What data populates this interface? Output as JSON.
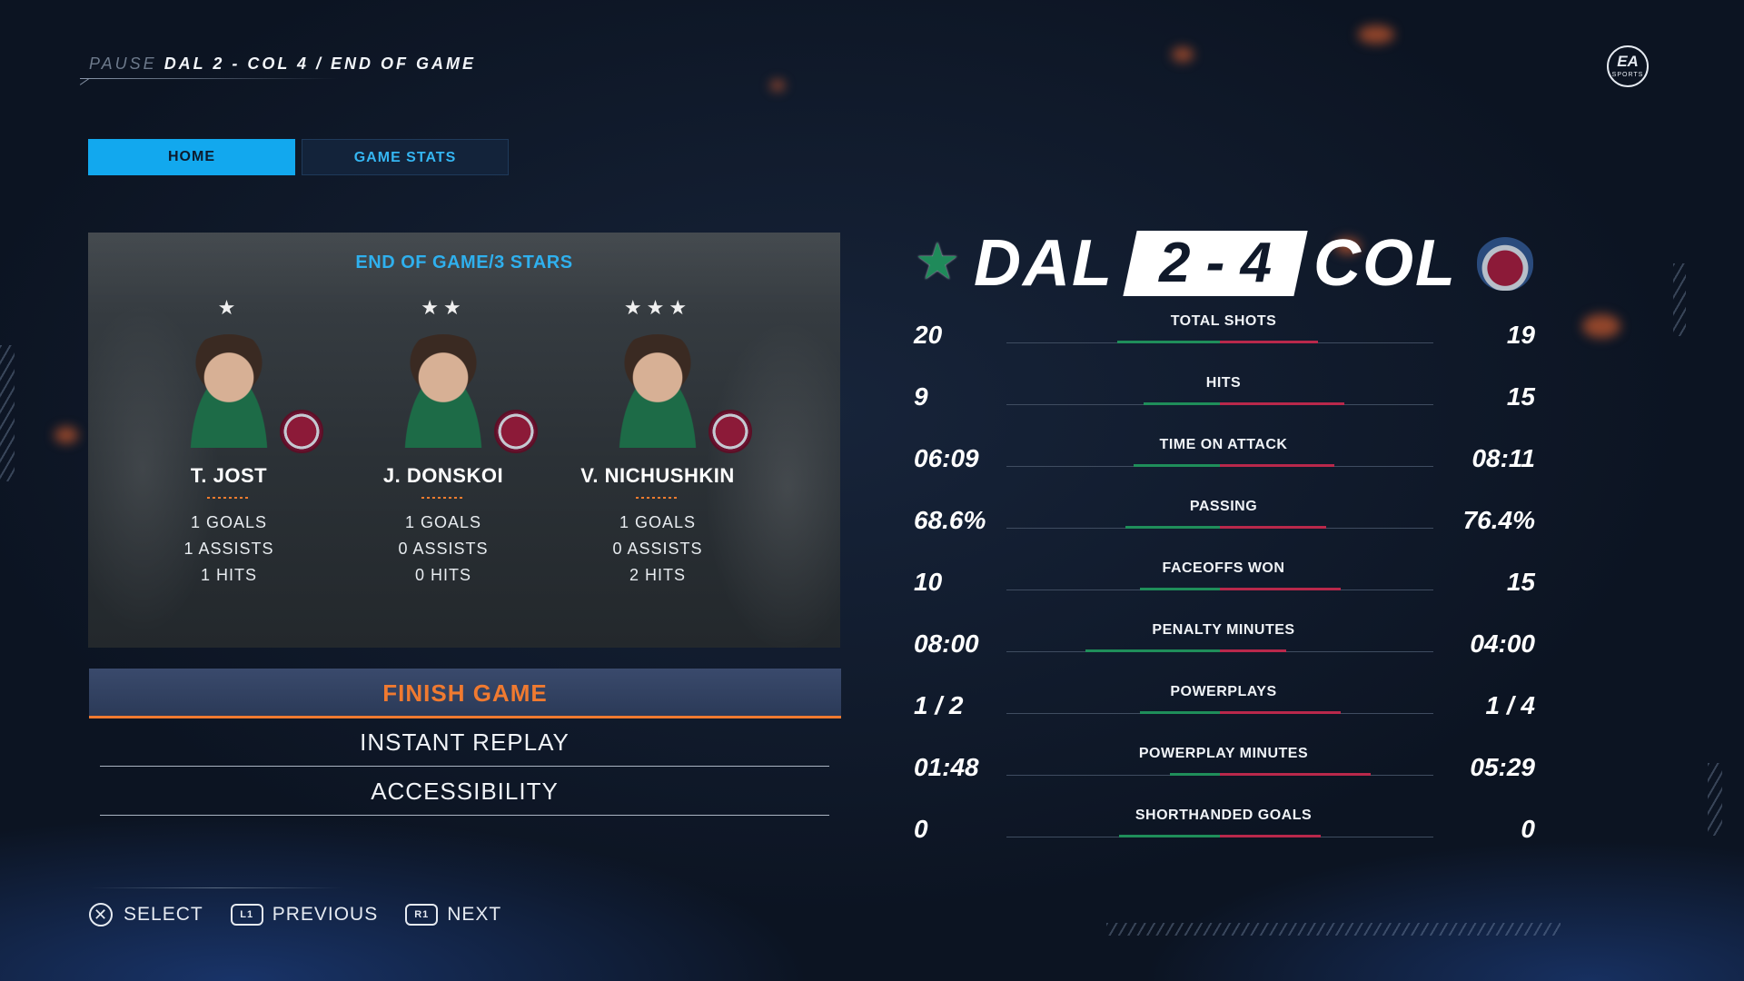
{
  "breadcrumb": {
    "pause": "PAUSE",
    "path": "DAL 2 - COL 4 / END OF GAME"
  },
  "brand": {
    "logo_text": "EA",
    "logo_subtext": "SPORTS"
  },
  "tabs": [
    {
      "label": "HOME",
      "active": true
    },
    {
      "label": "GAME STATS",
      "active": false
    }
  ],
  "stars_panel": {
    "title": "END OF GAME/3 STARS",
    "players": [
      {
        "rank": "★",
        "name": "T. JOST",
        "goals": "1 GOALS",
        "assists": "1 ASSISTS",
        "hits": "1 HITS"
      },
      {
        "rank": "★★",
        "name": "J. DONSKOI",
        "goals": "1 GOALS",
        "assists": "0 ASSISTS",
        "hits": "0 HITS"
      },
      {
        "rank": "★★★",
        "name": "V. NICHUSHKIN",
        "goals": "1 GOALS",
        "assists": "0 ASSISTS",
        "hits": "2 HITS"
      }
    ]
  },
  "menu": {
    "items": [
      "FINISH GAME",
      "INSTANT REPLAY",
      "ACCESSIBILITY"
    ],
    "selected": "FINISH GAME"
  },
  "hints": {
    "select": "SELECT",
    "previous": "PREVIOUS",
    "next": "NEXT",
    "l1": "L1",
    "r1": "R1",
    "x": "✕"
  },
  "score": {
    "home": "DAL",
    "away": "COL",
    "score": "2 - 4"
  },
  "colors": {
    "accent_blue": "#12a8ee",
    "orange": "#f07a30",
    "home_green": "#1f8e5a",
    "away_red": "#b9284b"
  },
  "stats": [
    {
      "label": "TOTAL SHOTS",
      "home": "20",
      "away": "19",
      "home_share": 0.51
    },
    {
      "label": "HITS",
      "home": "9",
      "away": "15",
      "home_share": 0.38
    },
    {
      "label": "TIME ON ATTACK",
      "home": "06:09",
      "away": "08:11",
      "home_share": 0.43
    },
    {
      "label": "PASSING",
      "home": "68.6%",
      "away": "76.4%",
      "home_share": 0.47
    },
    {
      "label": "FACEOFFS WON",
      "home": "10",
      "away": "15",
      "home_share": 0.4
    },
    {
      "label": "PENALTY MINUTES",
      "home": "08:00",
      "away": "04:00",
      "home_share": 0.67
    },
    {
      "label": "POWERPLAYS",
      "home": "1 / 2",
      "away": "1 / 4",
      "home_share": 0.4
    },
    {
      "label": "POWERPLAY MINUTES",
      "home": "01:48",
      "away": "05:29",
      "home_share": 0.25
    },
    {
      "label": "SHORTHANDED GOALS",
      "home": "0",
      "away": "0",
      "home_share": 0.5
    }
  ]
}
